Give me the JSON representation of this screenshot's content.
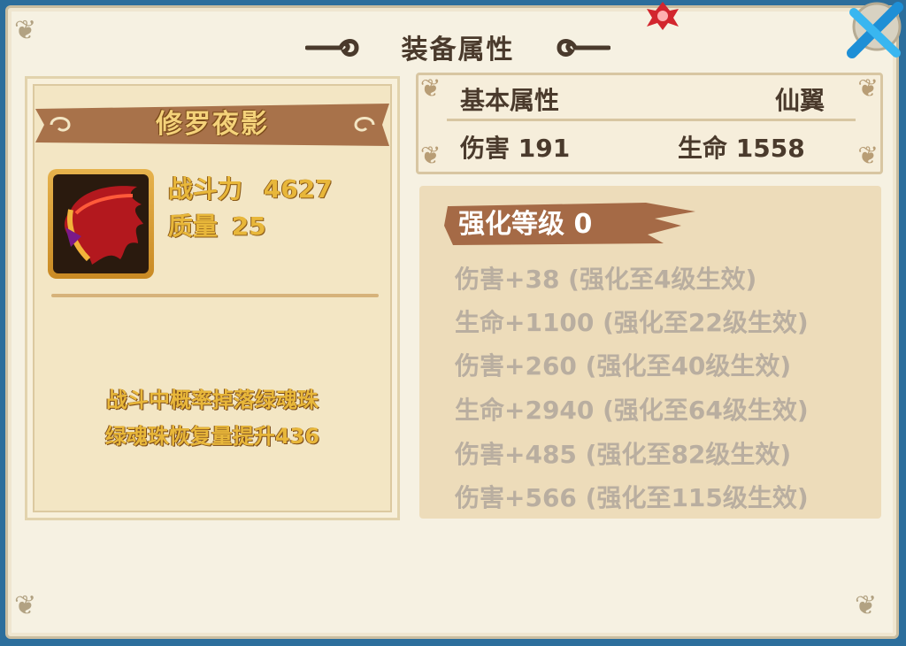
{
  "window": {
    "title": "装备属性"
  },
  "item": {
    "name": "修罗夜影",
    "combat_power_label": "战斗力",
    "combat_power_value": "4627",
    "quality_label": "质量",
    "quality_value": "25",
    "description": [
      "战斗中概率掉落绿魂珠",
      "绿魂珠恢复量提升436"
    ]
  },
  "base_attributes": {
    "heading": "基本属性",
    "category": "仙翼",
    "damage": "伤害 191",
    "life": "生命 1558"
  },
  "enhance": {
    "title": "强化等级 0",
    "bonuses": [
      "伤害+38 (强化至4级生效)",
      "生命+1100 (强化至22级生效)",
      "伤害+260 (强化至40级生效)",
      "生命+2940 (强化至64级生效)",
      "伤害+485 (强化至82级生效)",
      "伤害+566 (强化至115级生效)"
    ]
  },
  "icons": {
    "title_left": "cloud-scroll-left-icon",
    "title_right": "cloud-scroll-right-icon",
    "close": "close-button-icon",
    "item": "wing-item-icon",
    "top": "red-gem-icon"
  },
  "colors": {
    "frame_bg": "#f6f1e2",
    "gold_text": "#e8b73a",
    "banner_brown": "#a8724a",
    "disabled_text": "#b9aea0",
    "close_blue": "#2aa6e6"
  }
}
